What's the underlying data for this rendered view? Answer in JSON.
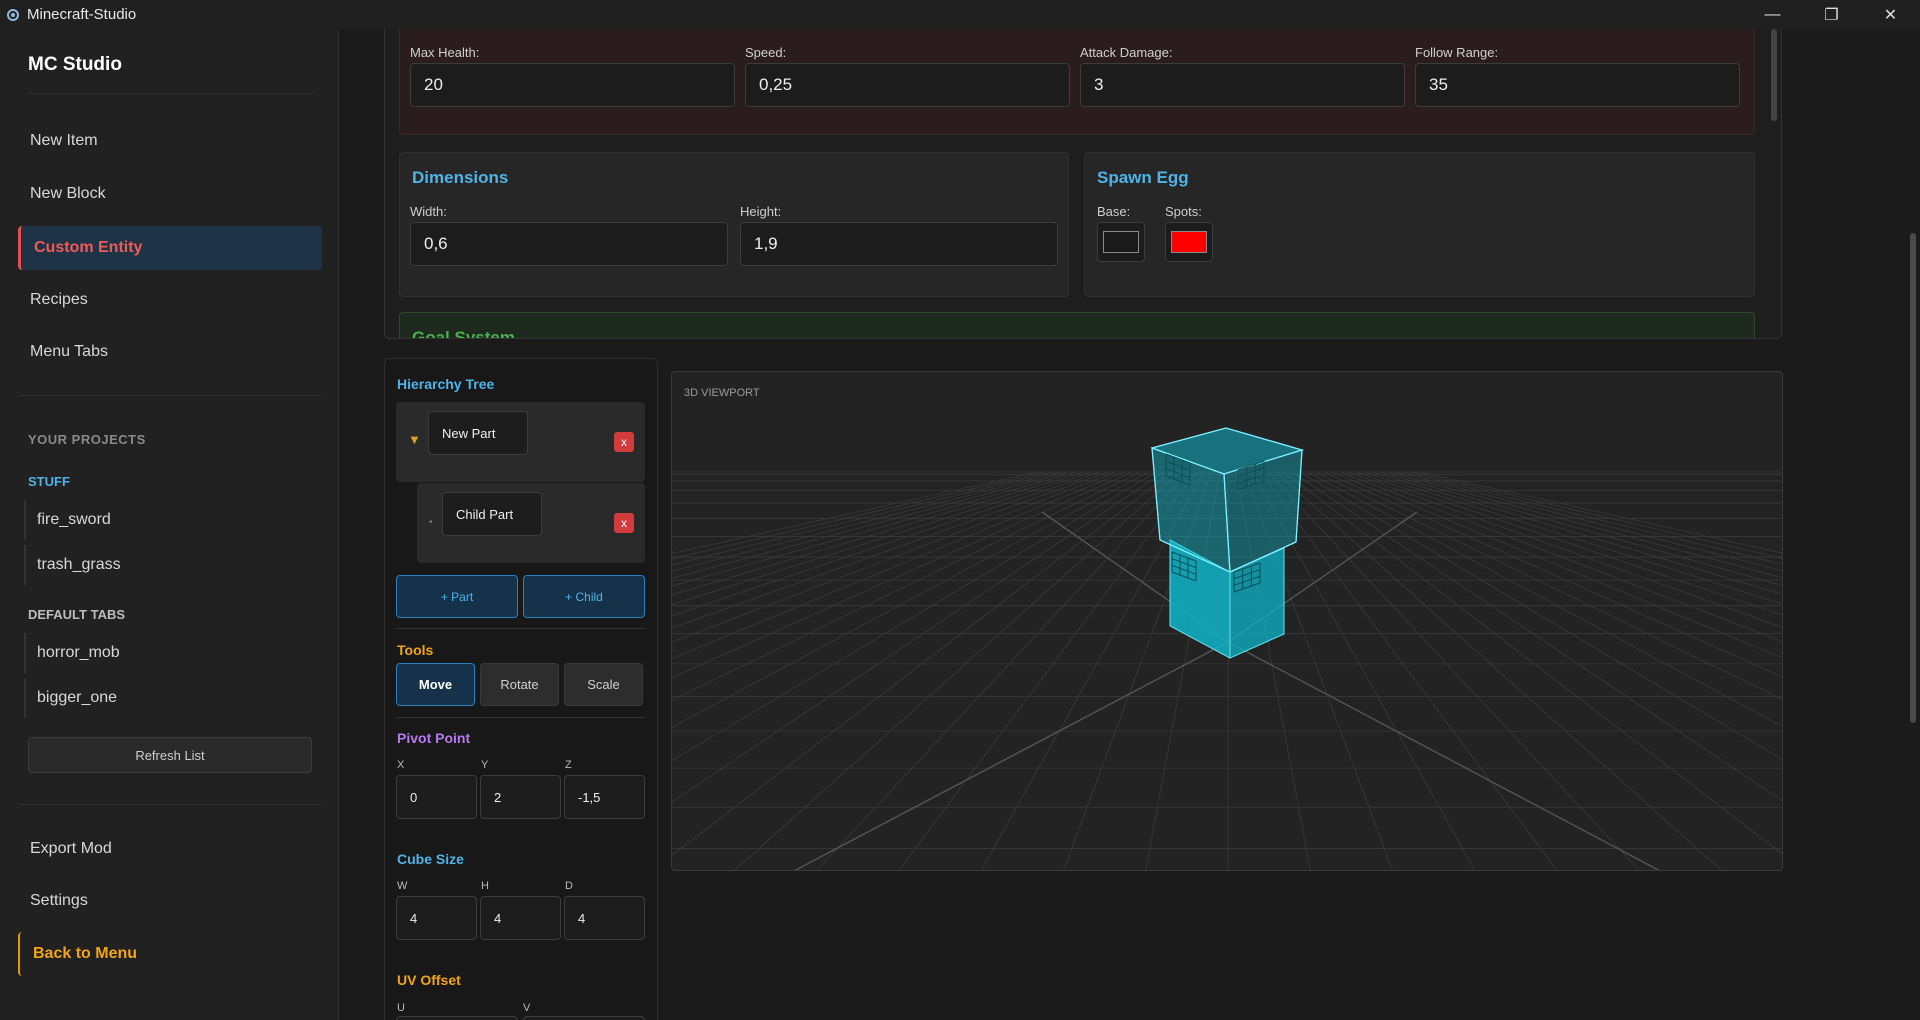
{
  "window": {
    "title": "Minecraft-Studio",
    "minimize_glyph": "—",
    "restore_glyph": "❐",
    "close_glyph": "✕"
  },
  "sidebar": {
    "brand": "MC Studio",
    "nav": [
      {
        "label": "New Item"
      },
      {
        "label": "New Block"
      },
      {
        "label": "Custom Entity",
        "active": true
      },
      {
        "label": "Recipes"
      },
      {
        "label": "Menu Tabs"
      }
    ],
    "projects_title": "YOUR PROJECTS",
    "groups": [
      {
        "title": "STUFF",
        "color": "#4fb3e8",
        "items": [
          "fire_sword",
          "trash_grass"
        ]
      },
      {
        "title": "DEFAULT TABS",
        "color": "#bdbdbd",
        "items": [
          "horror_mob",
          "bigger_one"
        ]
      }
    ],
    "refresh_label": "Refresh List",
    "bottom_nav": [
      {
        "label": "Export Mod"
      },
      {
        "label": "Settings"
      }
    ],
    "back_label": "Back to Menu"
  },
  "stats": {
    "max_health": {
      "label": "Max Health:",
      "value": "20"
    },
    "speed": {
      "label": "Speed:",
      "value": "0,25"
    },
    "attack_damage": {
      "label": "Attack Damage:",
      "value": "3"
    },
    "follow_range": {
      "label": "Follow Range:",
      "value": "35"
    }
  },
  "dimensions": {
    "title": "Dimensions",
    "width": {
      "label": "Width:",
      "value": "0,6"
    },
    "height": {
      "label": "Height:",
      "value": "1,9"
    }
  },
  "spawn_egg": {
    "title": "Spawn Egg",
    "base": {
      "label": "Base:",
      "color": "#1a1a1a"
    },
    "spots": {
      "label": "Spots:",
      "color": "#ff0000"
    }
  },
  "goal_system": {
    "title": "Goal System"
  },
  "hierarchy": {
    "title": "Hierarchy Tree",
    "nodes": [
      {
        "name": "New Part",
        "toggle": "▼",
        "delete": "x"
      },
      {
        "name": "Child Part",
        "toggle": "•",
        "delete": "x"
      }
    ],
    "add_part": "+ Part",
    "add_child": "+ Child"
  },
  "tools": {
    "title": "Tools",
    "move": "Move",
    "rotate": "Rotate",
    "scale": "Scale",
    "active": "Move"
  },
  "pivot": {
    "title": "Pivot Point",
    "labels": {
      "x": "X",
      "y": "Y",
      "z": "Z"
    },
    "values": {
      "x": "0",
      "y": "2",
      "z": "-1,5"
    }
  },
  "cube_size": {
    "title": "Cube Size",
    "labels": {
      "w": "W",
      "h": "H",
      "d": "D"
    },
    "values": {
      "w": "4",
      "h": "4",
      "d": "4"
    }
  },
  "uv_offset": {
    "title": "UV Offset",
    "labels": {
      "u": "U",
      "v": "V"
    }
  },
  "viewport": {
    "label": "3D VIEWPORT",
    "model_color": "#0fb5c9",
    "grid_color": "#3a3a3a"
  }
}
